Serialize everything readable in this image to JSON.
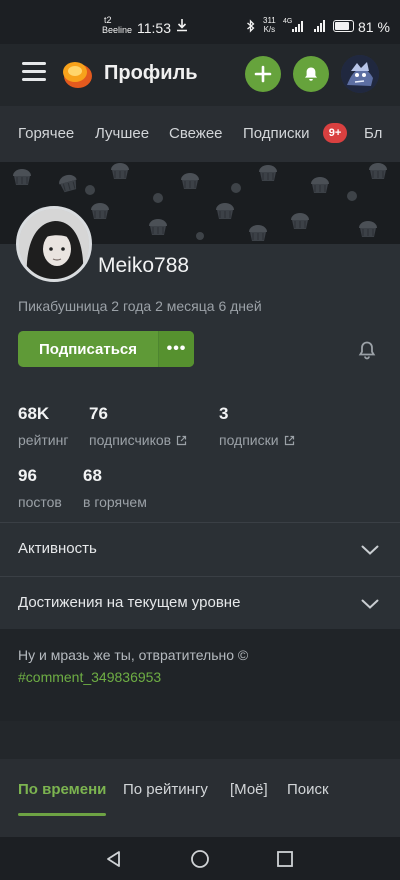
{
  "status_bar": {
    "carrier_line1": "t2",
    "carrier_line2": "Beeline",
    "time": "11:53",
    "speed_value": "311",
    "speed_unit": "K/s",
    "network_type": "4G",
    "battery_percent": "81 %",
    "battery_level": 0.81
  },
  "header": {
    "title": "Профиль"
  },
  "top_tabs": [
    {
      "label": "Горячее"
    },
    {
      "label": "Лучшее"
    },
    {
      "label": "Свежее"
    },
    {
      "label": "Подписки"
    },
    {
      "label": "Бл"
    }
  ],
  "subscriptions_badge": "9+",
  "profile": {
    "username": "Meiko788",
    "since": "Пикабушница 2 года 2 месяца 6 дней",
    "subscribe_label": "Подписаться",
    "more_label": "•••",
    "stats": {
      "rating_value": "68K",
      "rating_label": "рейтинг",
      "followers_value": "76",
      "followers_label": "подписчиков",
      "following_value": "3",
      "following_label": "подписки",
      "posts_value": "96",
      "posts_label": "постов",
      "hot_value": "68",
      "hot_label": "в горячем"
    }
  },
  "sections": {
    "activity": "Активность",
    "achievements": "Достижения на текущем уровне"
  },
  "comment": {
    "quote": "Ну и мразь же ты, отвратительно ©",
    "link": "#comment_349836953"
  },
  "sort_tabs": [
    {
      "label": "По времени"
    },
    {
      "label": "По рейтингу"
    },
    {
      "label": "[Моё]"
    },
    {
      "label": "Поиск"
    }
  ],
  "colors": {
    "accent_green": "#66a33c",
    "badge_red": "#d94040",
    "background": "#23272b"
  }
}
